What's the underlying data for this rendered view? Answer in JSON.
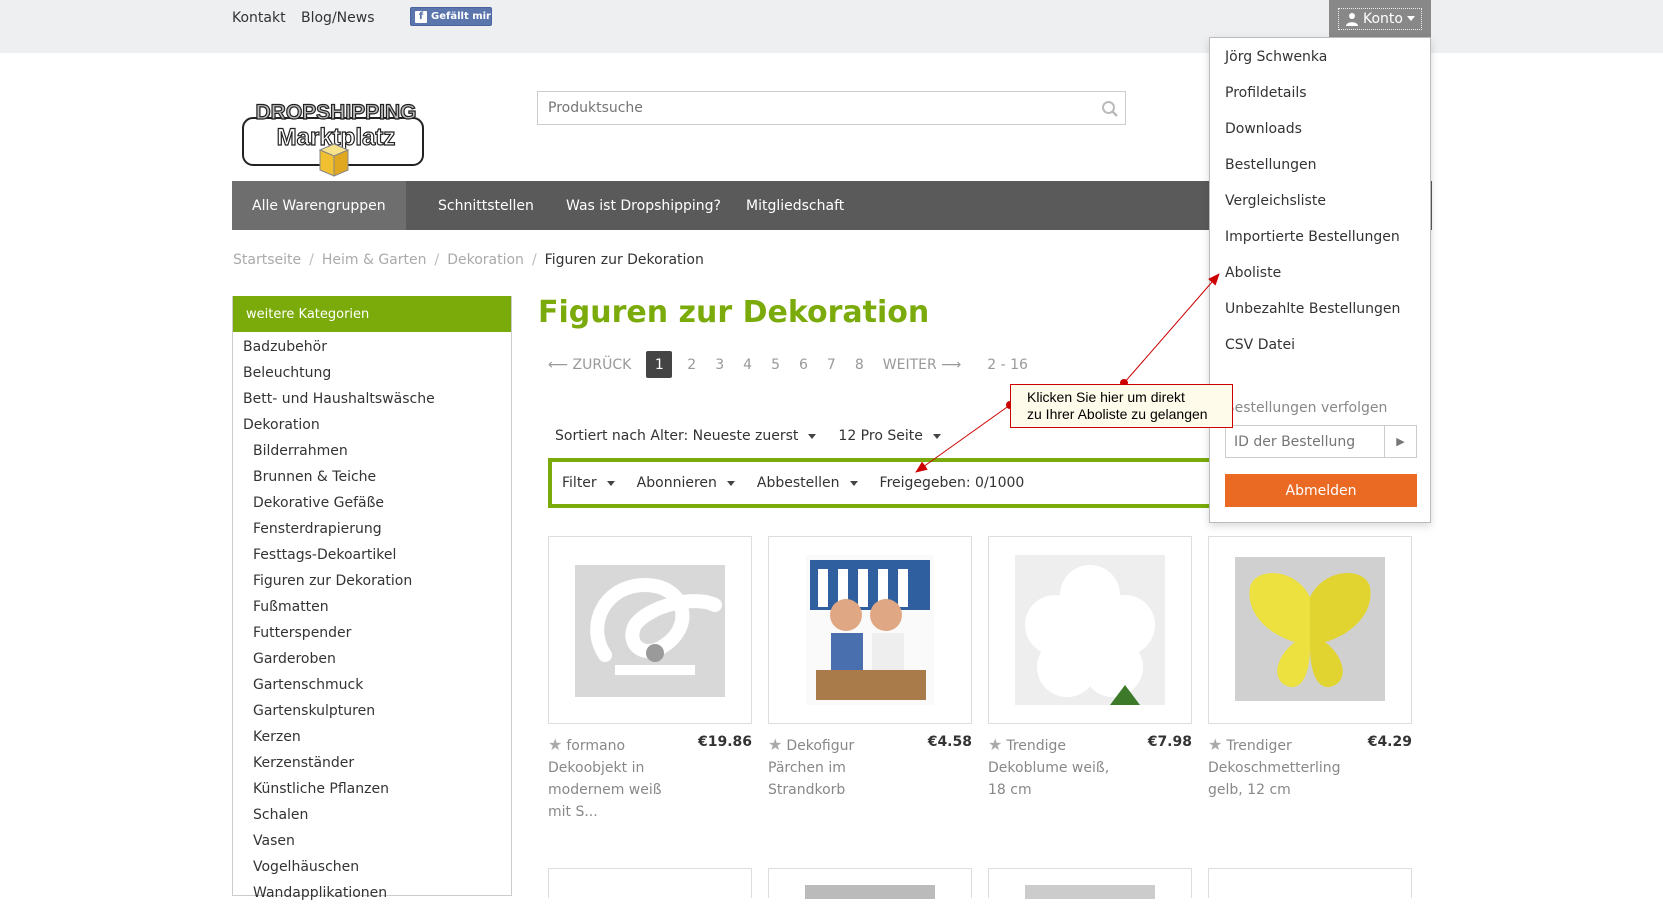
{
  "topbar": {
    "links": [
      "Kontakt",
      "Blog/News"
    ],
    "facebook_label": "Gefällt mir",
    "account_label": "Konto"
  },
  "logo": {
    "line1": "DROPSHIPPING",
    "line2": "Marktplatz"
  },
  "search": {
    "placeholder": "Produktsuche"
  },
  "mainnav": [
    "Alle Warengruppen",
    "Schnittstellen",
    "Was ist Dropshipping?",
    "Mitgliedschaft"
  ],
  "breadcrumb": [
    "Startseite",
    "Heim & Garten",
    "Dekoration",
    "Figuren zur Dekoration"
  ],
  "sidebar": {
    "title": "weitere Kategorien",
    "categories": [
      "Badzubehör",
      "Beleuchtung",
      "Bett- und Haushaltswäsche",
      "Dekoration"
    ],
    "subcategories": [
      "Bilderrahmen",
      "Brunnen & Teiche",
      "Dekorative Gefäße",
      "Fensterdrapierung",
      "Festtags-Dekoartikel",
      "Figuren zur Dekoration",
      "Fußmatten",
      "Futterspender",
      "Garderoben",
      "Gartenschmuck",
      "Gartenskulpturen",
      "Kerzen",
      "Kerzenständer",
      "Künstliche Pflanzen",
      "Schalen",
      "Vasen",
      "Vogelhäuschen",
      "Wandapplikationen"
    ]
  },
  "page_title": "Figuren zur Dekoration",
  "pager": {
    "prev": "⟵ ZURÜCK",
    "pages": [
      "1",
      "2",
      "3",
      "4",
      "5",
      "6",
      "7",
      "8"
    ],
    "current": "1",
    "next": "WEITER ⟶",
    "range": "2 - 16"
  },
  "sort": {
    "order": "Sortiert nach Alter: Neueste zuerst",
    "per_page": "12 Pro Seite"
  },
  "filterbar": {
    "filter": "Filter",
    "subscribe": "Abonnieren",
    "unsubscribe": "Abbestellen",
    "released": "Freigegeben: 0/1000"
  },
  "products": [
    {
      "name": "formano Dekoobjekt in modernem weiß mit S...",
      "price": "€19.86"
    },
    {
      "name": "Dekofigur Pärchen im Strandkorb",
      "price": "€4.58"
    },
    {
      "name": "Trendige Dekoblume weiß, 18 cm",
      "price": "€7.98"
    },
    {
      "name": "Trendiger Dekoschmetterling gelb, 12 cm",
      "price": "€4.29"
    }
  ],
  "account_menu": {
    "items": [
      "Jörg Schwenka",
      "Profildetails",
      "Downloads",
      "Bestellungen",
      "Vergleichsliste",
      "Importierte Bestellungen",
      "Aboliste",
      "Unbezahlte Bestellungen",
      "CSV Datei"
    ],
    "track_label": "Bestellungen verfolgen",
    "order_id_placeholder": "ID der Bestellung",
    "logout": "Abmelden"
  },
  "annotation": {
    "line1": "Klicken Sie hier um direkt",
    "line2": "zu Ihrer Aboliste zu gelangen"
  },
  "colors": {
    "brand_green": "#7aab0a",
    "logout_orange": "#ea6a24",
    "nav_gray": "#5a5a5a",
    "annotation_red": "#cc0000"
  }
}
